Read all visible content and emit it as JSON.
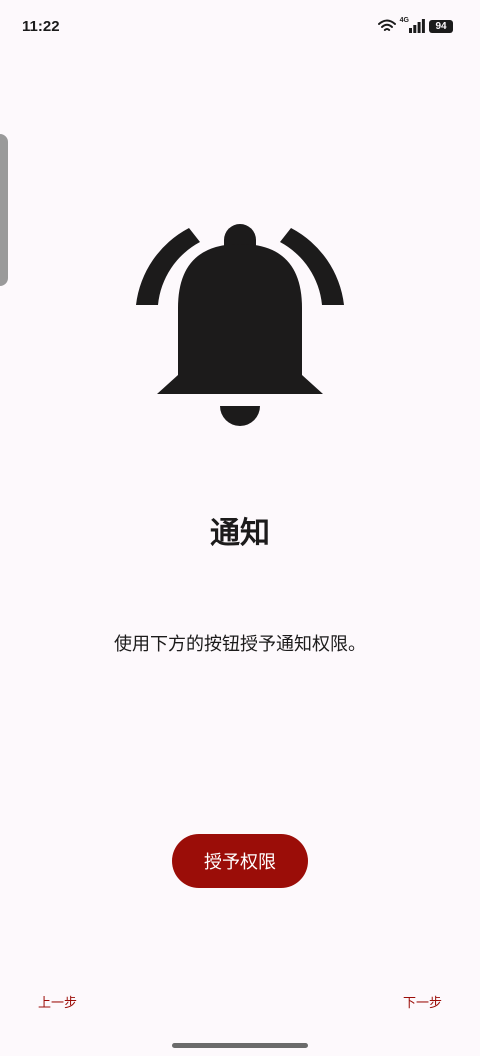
{
  "status_bar": {
    "time": "11:22",
    "network": "4G",
    "battery": "94",
    "icons": [
      "wifi-icon",
      "signal-icon",
      "battery-icon"
    ]
  },
  "main": {
    "icon": "bell-ringing-icon",
    "title": "通知",
    "description": "使用下方的按钮授予通知权限。",
    "grant_button": "授予权限"
  },
  "nav": {
    "prev_label": "上一步",
    "next_label": "下一步"
  },
  "colors": {
    "accent": "#9b0d08",
    "background": "#fdf9fc",
    "text": "#1c1b1b"
  }
}
